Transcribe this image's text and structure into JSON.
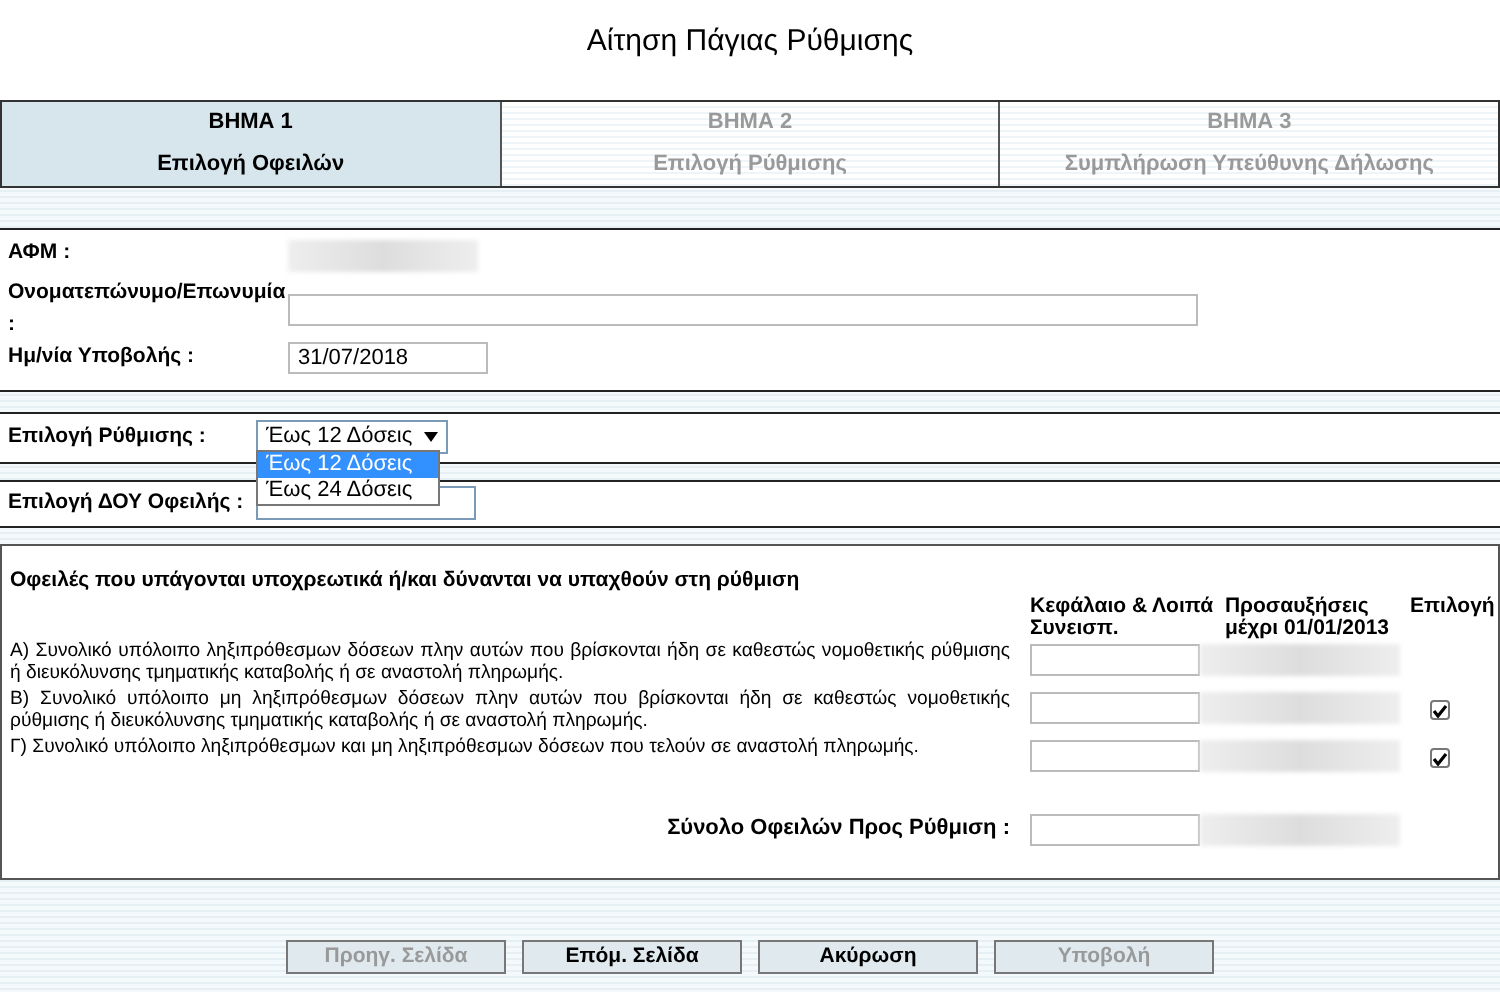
{
  "title": "Αίτηση Πάγιας Ρύθμισης",
  "steps": [
    {
      "number": "ΒΗΜΑ 1",
      "label": "Επιλογή Οφειλών",
      "selected": true
    },
    {
      "number": "ΒΗΜΑ 2",
      "label": "Επιλογή Ρύθμισης",
      "selected": false
    },
    {
      "number": "ΒΗΜΑ 3",
      "label": "Συμπλήρωση Υπεύθυνης Δήλωσης",
      "selected": false
    }
  ],
  "taxpayer": [
    {
      "label": "ΑΦΜ :",
      "kind": "blurred"
    },
    {
      "label": "Ονοματεπώνυμο/Επωνυμία :",
      "kind": "wide"
    },
    {
      "label": "Ημ/νία Υποβολής :",
      "kind": "field",
      "value": "31/07/2018"
    }
  ],
  "settlement": {
    "label": "Επιλογή Ρύθμισης :",
    "value": "Έως 12 Δόσεις",
    "expanded": true,
    "options": [
      {
        "label": "Έως 12 Δόσεις",
        "selected": true
      },
      {
        "label": "Έως 24 Δόσεις",
        "selected": false
      }
    ]
  },
  "tax_office": {
    "label": "Επιλογή ΔΟΥ Οφειλής :"
  },
  "debts": {
    "heading": "Οφειλές που υπάγονται υποχρεωτικά ή/και δύνανται να υπαχθούν στη ρύθμιση",
    "columns": [
      "Κεφάλαιο & Λοιπά Συνεισπ.",
      "Προσαυξήσεις μέχρι 01/01/2013",
      "Επιλογή"
    ],
    "rows": [
      {
        "text": "Α) Συνολικό υπόλοιπο ληξιπρόθεσμων δόσεων πλην αυτών που βρίσκονται ήδη σε καθεστώς νομοθετικής ρύθμισης ή διευκόλυνσης τμηματικής καταβολής ή σε αναστολή πληρωμής.",
        "kind": "plain"
      },
      {
        "text": "Β) Συνολικό υπόλοιπο μη ληξιπρόθεσμων δόσεων πλην αυτών που βρίσκονται ήδη σε καθεστώς νομοθετικής ρύθμισης ή διευκόλυνσης τμηματικής καταβολής ή σε αναστολή πληρωμής.",
        "kind": "checkbox",
        "checked": true
      },
      {
        "text": "Γ) Συνολικό υπόλοιπο ληξιπρόθεσμων και μη ληξιπρόθεσμων δόσεων που τελούν σε αναστολή πληρωμής.",
        "kind": "checkbox",
        "checked": true
      }
    ],
    "total_label": "Σύνολο Οφειλών Προς Ρύθμιση :"
  },
  "buttons": [
    {
      "label": "Προηγ. Σελίδα",
      "disabled": true
    },
    {
      "label": "Επόμ. Σελίδα",
      "disabled": false
    },
    {
      "label": "Ακύρωση",
      "disabled": false
    },
    {
      "label": "Υποβολή",
      "disabled": true
    }
  ]
}
